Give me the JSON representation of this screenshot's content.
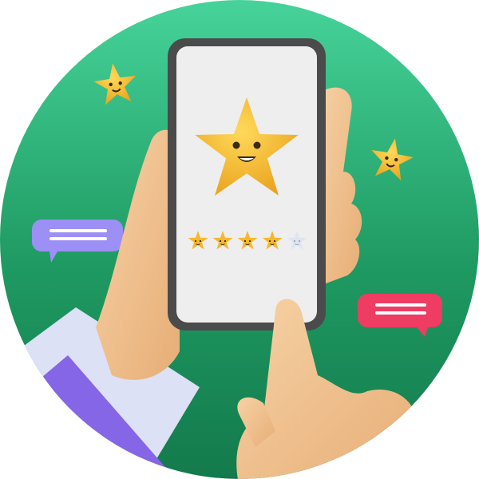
{
  "rating": {
    "value": 4,
    "max": 5,
    "star_color": "#f5b82e",
    "empty_star_color": "#dfe4f0"
  },
  "colors": {
    "background_top": "#46d39a",
    "background_bottom": "#137a4c",
    "phone_frame": "#4b4b4b",
    "phone_screen": "#eeeeee",
    "chat_left": "#9c8ff5",
    "chat_right": "#ee3c63",
    "sleeve": "#dce1f5",
    "cuff": "#8566e6",
    "skin": "#f0c08e"
  },
  "icons": [
    "big-smiling-star-icon",
    "floating-star-icon",
    "chat-bubble-icon"
  ]
}
